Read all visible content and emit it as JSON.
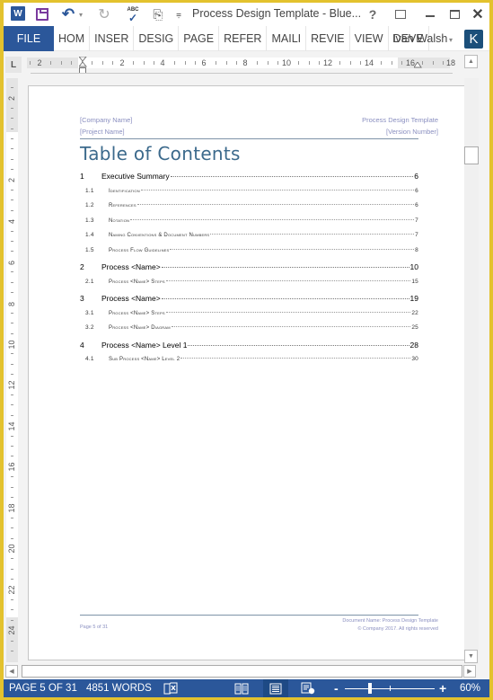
{
  "app": {
    "title": "Process Design Template - Blue...",
    "word_icon_label": "W",
    "help_label": "?",
    "close_label": "✕"
  },
  "qat": {
    "undo_glyph": "↶",
    "undo_dropdown": "▾",
    "redo_glyph": "↻",
    "spelling_abc": "ABC",
    "spelling_check": "✓",
    "form_glyph": "⎘",
    "customize_glyph": "⩦"
  },
  "ribbon": {
    "file_label": "FILE",
    "tabs": [
      "HOM",
      "INSER",
      "DESIG",
      "PAGE",
      "REFER",
      "MAILI",
      "REVIE",
      "VIEW",
      "DEVE"
    ],
    "user_name": "Ivan Walsh",
    "user_dropdown": "▾",
    "user_initial": "K"
  },
  "ruler": {
    "tab_selector_glyph": "L",
    "horizontal_numbers": [
      "2",
      "2",
      "4",
      "6",
      "8",
      "10",
      "12",
      "14",
      "16",
      "18"
    ],
    "vertical_numbers": [
      "2",
      "2",
      "4",
      "6",
      "8",
      "10",
      "12",
      "14",
      "16",
      "18",
      "20",
      "22",
      "24"
    ]
  },
  "document": {
    "header": {
      "company": "[Company Name]",
      "project": "[Project Name]",
      "template": "Process Design Template",
      "version": "[Version Number]"
    },
    "toc_title": "Table of Contents",
    "toc": [
      {
        "level": 1,
        "num": "1",
        "label": "Executive Summary",
        "page": "6"
      },
      {
        "level": 2,
        "num": "1.1",
        "label": "Identification",
        "page": "6"
      },
      {
        "level": 2,
        "num": "1.2",
        "label": "References",
        "page": "6"
      },
      {
        "level": 2,
        "num": "1.3",
        "label": "Notation",
        "page": "7"
      },
      {
        "level": 2,
        "num": "1.4",
        "label": "Naming Conventions & Document Numbers",
        "page": "7"
      },
      {
        "level": 2,
        "num": "1.5",
        "label": "Process Flow Guidelines",
        "page": "8"
      },
      {
        "level": 1,
        "num": "2",
        "label": "Process <Name>",
        "page": "10"
      },
      {
        "level": 2,
        "num": "2.1",
        "label": "Process <Name> Steps",
        "page": "15"
      },
      {
        "level": 1,
        "num": "3",
        "label": "Process <Name>",
        "page": "19"
      },
      {
        "level": 2,
        "num": "3.1",
        "label": "Process <Name> Steps",
        "page": "22"
      },
      {
        "level": 2,
        "num": "3.2",
        "label": "Process <Name> Diagram",
        "page": "25"
      },
      {
        "level": 1,
        "num": "4",
        "label": "Process <Name> Level 1",
        "page": "28"
      },
      {
        "level": 2,
        "num": "4.1",
        "label": "Sub Process <Name> Level 2",
        "page": "30"
      }
    ],
    "footer": {
      "page": "Page 5 of 31",
      "doc_name": "Document Name: Process Design Template",
      "copyright": "© Company 2017. All rights reserved"
    }
  },
  "scrollbars": {
    "up": "▲",
    "down": "▼",
    "left": "◀",
    "right": "▶"
  },
  "status": {
    "page": "PAGE 5 OF 31",
    "words": "4851 WORDS",
    "proofing_glyph": "⎕✕",
    "read_mode_glyph": "📖",
    "print_layout_glyph": "☰",
    "web_layout_glyph": "🗎",
    "zoom_out": "-",
    "zoom_in": "+",
    "zoom": "60%",
    "zoom_level_percent": 60
  }
}
